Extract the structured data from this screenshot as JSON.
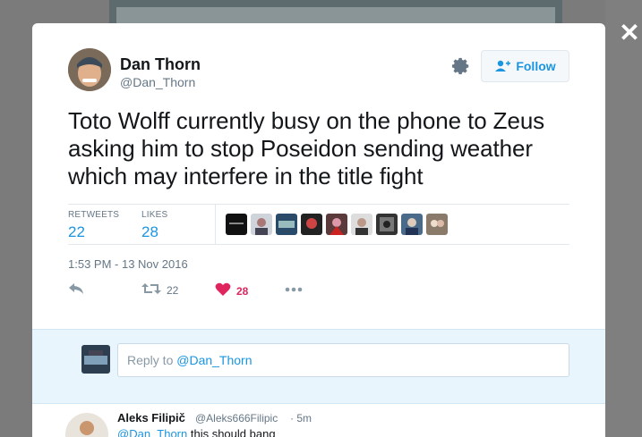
{
  "tweet": {
    "author_name": "Dan Thorn",
    "author_handle": "@Dan_Thorn",
    "follow_label": "Follow",
    "text": "Toto Wolff currently busy on the phone to Zeus asking him to stop Poseidon sending weather which may interfere in the title fight",
    "retweets_label": "RETWEETS",
    "retweets_count": "22",
    "likes_label": "LIKES",
    "likes_count": "28",
    "timestamp": "1:53 PM - 13 Nov 2016",
    "actions": {
      "reply_icon": "reply-icon",
      "retweet_icon": "retweet-icon",
      "retweet_count": "22",
      "like_icon": "heart-icon",
      "like_count": "28",
      "more_icon": "more-dots-icon"
    }
  },
  "reply_box": {
    "placeholder_prefix": "Reply to ",
    "placeholder_mention": "@Dan_Thorn"
  },
  "reply_tweet": {
    "author_name": "Aleks Filipič",
    "author_handle": "@Aleks666Filipic",
    "time": "· 5m",
    "mention": "@Dan_Thorn",
    "text": " this should bang"
  },
  "colors": {
    "accent": "#1b95e0",
    "like": "#e0245e",
    "muted": "#657786",
    "reply_area": "#e8f5fd"
  }
}
